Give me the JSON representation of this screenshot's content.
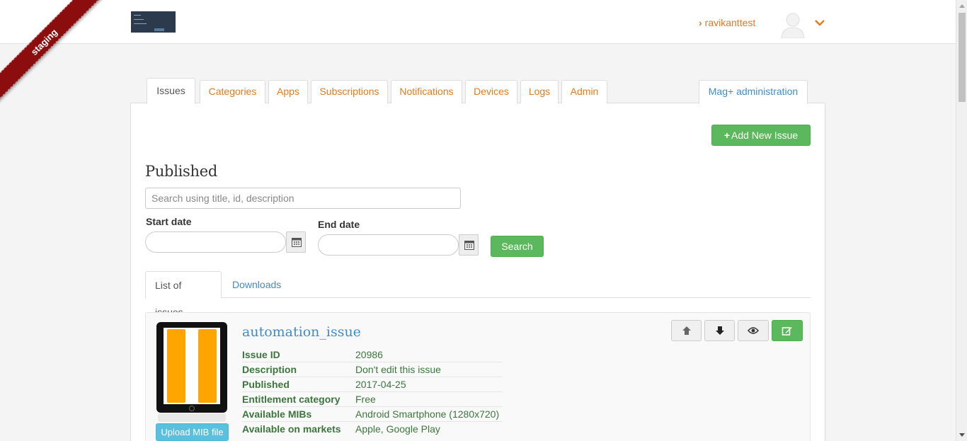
{
  "env": {
    "ribbon_label": "staging"
  },
  "header": {
    "username": "ravikanttest",
    "user_chevron": "›"
  },
  "tabs": [
    {
      "label": "Issues",
      "active": true
    },
    {
      "label": "Categories"
    },
    {
      "label": "Apps"
    },
    {
      "label": "Subscriptions"
    },
    {
      "label": "Notifications"
    },
    {
      "label": "Devices"
    },
    {
      "label": "Logs"
    },
    {
      "label": "Admin"
    }
  ],
  "mag_admin_label": "Mag+ administration",
  "toolbar": {
    "add_label": "Add New Issue",
    "add_icon": "+"
  },
  "section_title": "Published",
  "search": {
    "placeholder": "Search using title, id, description",
    "start_label": "Start date",
    "end_label": "End date",
    "button_label": "Search"
  },
  "subtabs": [
    {
      "label": "List of issues",
      "active": true
    },
    {
      "label": "Downloads"
    }
  ],
  "issue": {
    "title": "automation_issue",
    "upload_label": "Upload MIB file",
    "fields": [
      {
        "key": "Issue ID",
        "value": "20986"
      },
      {
        "key": "Description",
        "value": "Don't edit this issue"
      },
      {
        "key": "Published",
        "value": "2017-04-25"
      },
      {
        "key": "Entitlement category",
        "value": "Free"
      },
      {
        "key": "Available MIBs",
        "value": "Android Smartphone (1280x720)"
      },
      {
        "key": "Available on markets",
        "value": "Apple, Google Play"
      }
    ],
    "actions": [
      "arrow-up-icon",
      "arrow-down-icon",
      "eye-icon",
      "edit-icon"
    ]
  },
  "colors": {
    "accent": "#e07b20",
    "link": "#428bca",
    "success": "#5cb85c",
    "info": "#5bc0de",
    "ribbon": "#8b0d0d"
  }
}
